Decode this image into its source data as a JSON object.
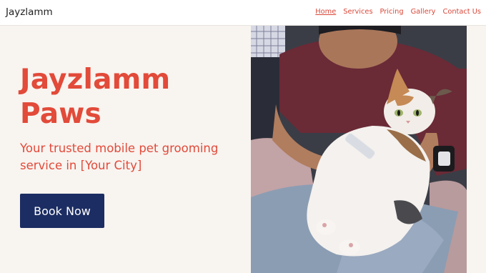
{
  "header": {
    "brand": "Jayzlamm",
    "nav": [
      {
        "label": "Home",
        "active": true
      },
      {
        "label": "Services",
        "active": false
      },
      {
        "label": "Pricing",
        "active": false
      },
      {
        "label": "Gallery",
        "active": false
      },
      {
        "label": "Contact Us",
        "active": false
      }
    ]
  },
  "hero": {
    "title_line1": "Jayzlamm",
    "title_line2": "Paws",
    "subtitle_line1": "Your trusted mobile pet grooming",
    "subtitle_line2": "service in [Your City]",
    "cta_label": "Book Now"
  },
  "colors": {
    "accent": "#e24a39",
    "button": "#1c2d63",
    "background": "#f8f4f0",
    "header_bg": "#ffffff"
  }
}
